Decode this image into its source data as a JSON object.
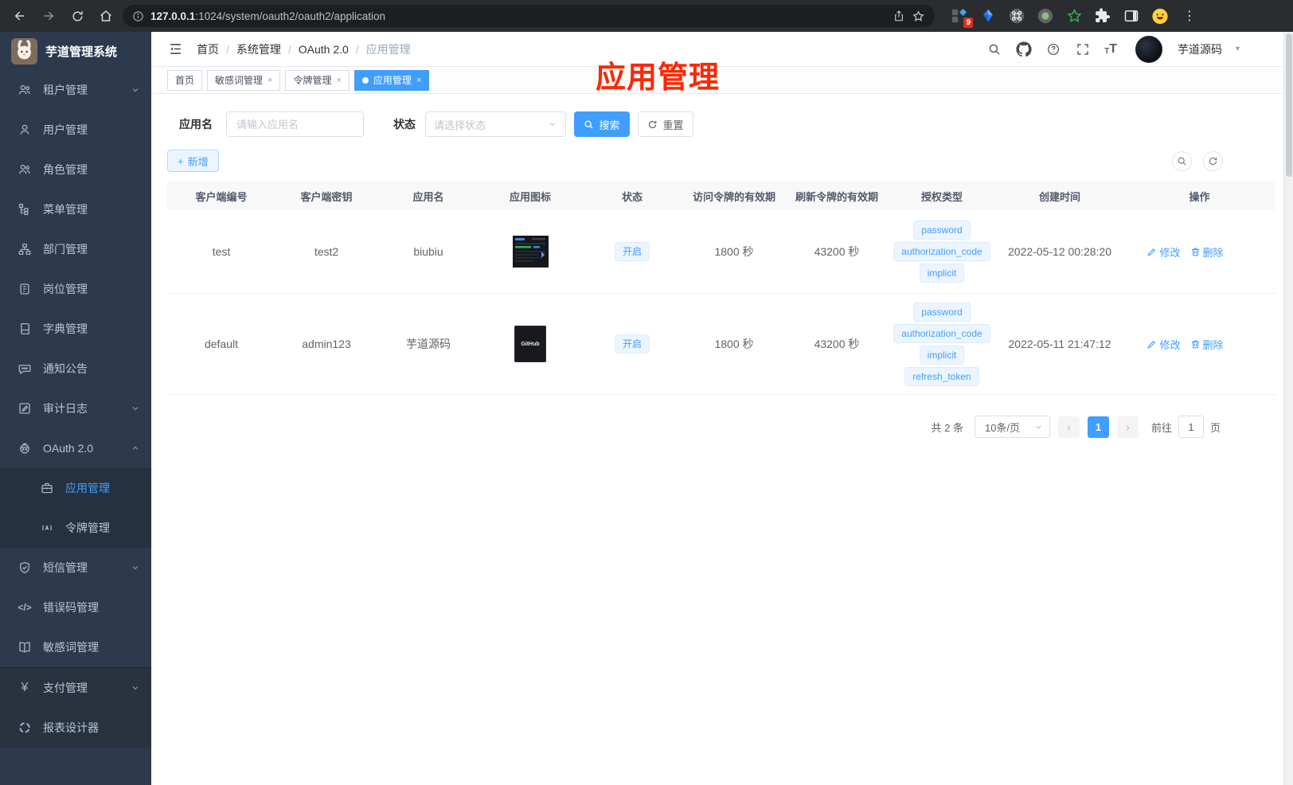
{
  "browser": {
    "url_host": "127.0.0.1",
    "url_rest": ":1024/system/oauth2/oauth2/application",
    "extension_badge": "9"
  },
  "sidebar": {
    "logo_title": "芋道管理系统",
    "items": [
      {
        "label": "租户管理"
      },
      {
        "label": "用户管理"
      },
      {
        "label": "角色管理"
      },
      {
        "label": "菜单管理"
      },
      {
        "label": "部门管理"
      },
      {
        "label": "岗位管理"
      },
      {
        "label": "字典管理"
      },
      {
        "label": "通知公告"
      },
      {
        "label": "审计日志"
      },
      {
        "label": "OAuth 2.0"
      },
      {
        "label": "应用管理"
      },
      {
        "label": "令牌管理"
      },
      {
        "label": "短信管理"
      },
      {
        "label": "错误码管理"
      },
      {
        "label": "敏感词管理"
      },
      {
        "label": "支付管理"
      },
      {
        "label": "报表设计器"
      }
    ]
  },
  "navbar": {
    "breadcrumb": [
      "首页",
      "系统管理",
      "OAuth 2.0",
      "应用管理"
    ],
    "separator": "/",
    "username": "芋道源码"
  },
  "tabs": [
    {
      "label": "首页"
    },
    {
      "label": "敏感词管理"
    },
    {
      "label": "令牌管理"
    },
    {
      "label": "应用管理"
    }
  ],
  "annotation": {
    "text": "应用管理"
  },
  "filters": {
    "name_label": "应用名",
    "name_placeholder": "请输入应用名",
    "status_label": "状态",
    "status_placeholder": "请选择状态",
    "search_label": "搜索",
    "reset_label": "重置"
  },
  "toolbar": {
    "add_label": "新增"
  },
  "table": {
    "columns": [
      "客户端编号",
      "客户端密钥",
      "应用名",
      "应用图标",
      "状态",
      "访问令牌的有效期",
      "刷新令牌的有效期",
      "授权类型",
      "创建时间",
      "操作"
    ],
    "rows": [
      {
        "client_id": "test",
        "secret": "test2",
        "name": "biubiu",
        "status": "开启",
        "access_ttl": "1800 秒",
        "refresh_ttl": "43200 秒",
        "grant_types": [
          "password",
          "authorization_code",
          "implicit"
        ],
        "created": "2022-05-12 00:28:20",
        "edit": "修改",
        "delete": "删除"
      },
      {
        "client_id": "default",
        "secret": "admin123",
        "name": "芋道源码",
        "icon_text": "GitHub",
        "status": "开启",
        "access_ttl": "1800 秒",
        "refresh_ttl": "43200 秒",
        "grant_types": [
          "password",
          "authorization_code",
          "implicit",
          "refresh_token"
        ],
        "created": "2022-05-11 21:47:12",
        "edit": "修改",
        "delete": "删除"
      }
    ]
  },
  "pagination": {
    "total": "共 2 条",
    "page_size": "10条/页",
    "current": "1",
    "goto_label": "前往",
    "goto_value": "1",
    "page_unit": "页"
  },
  "icons": {
    "close": "×",
    "plus": "+",
    "kebab": "⋮",
    "caret_down": "▾",
    "code": "</>",
    "yen": "¥",
    "question": "?",
    "prev": "‹",
    "next": "›",
    "t_small": "T",
    "t_large": "T"
  },
  "colors": {
    "primary": "#409eff",
    "annotation": "#ff2600",
    "sidebar_bg": "#2d3a4d",
    "tag_bg": "#ecf5ff"
  }
}
